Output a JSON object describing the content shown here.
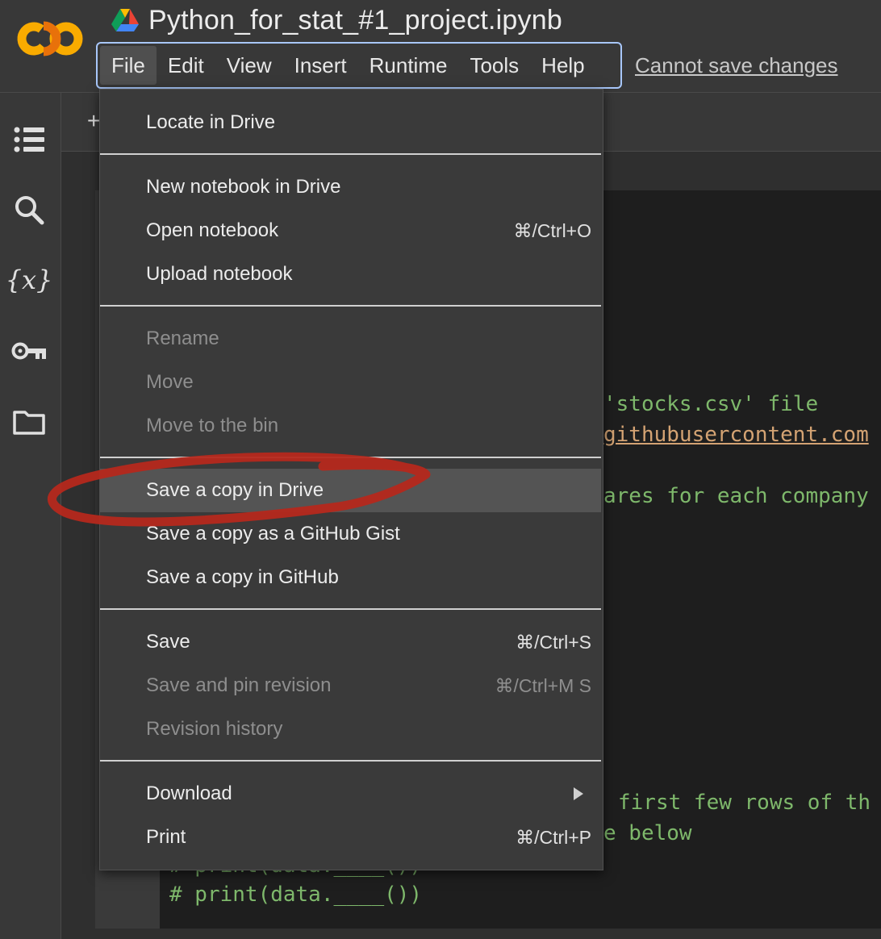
{
  "app": {
    "title": "Python_for_stat_#1_project.ipynb",
    "save_status": "Cannot save changes"
  },
  "menubar": [
    "File",
    "Edit",
    "View",
    "Insert",
    "Runtime",
    "Tools",
    "Help"
  ],
  "toolbar": {
    "add_symbol": "+"
  },
  "sidebar": {
    "icons": [
      "table-of-contents-icon",
      "search-icon",
      "variables-icon",
      "secrets-key-icon",
      "files-folder-icon"
    ],
    "variables_glyph": "{x}"
  },
  "file_menu": {
    "items": [
      {
        "label": "Locate in Drive",
        "shortcut": "",
        "disabled": false
      },
      {
        "label": "New notebook in Drive",
        "shortcut": "",
        "disabled": false
      },
      {
        "label": "Open notebook",
        "shortcut": "⌘/Ctrl+O",
        "disabled": false
      },
      {
        "label": "Upload notebook",
        "shortcut": "",
        "disabled": false
      },
      {
        "label": "Rename",
        "shortcut": "",
        "disabled": true
      },
      {
        "label": "Move",
        "shortcut": "",
        "disabled": true
      },
      {
        "label": "Move to the bin",
        "shortcut": "",
        "disabled": true
      },
      {
        "label": "Save a copy in Drive",
        "shortcut": "",
        "disabled": false,
        "highlighted": true
      },
      {
        "label": "Save a copy as a GitHub Gist",
        "shortcut": "",
        "disabled": false
      },
      {
        "label": "Save a copy in GitHub",
        "shortcut": "",
        "disabled": false
      },
      {
        "label": "Save",
        "shortcut": "⌘/Ctrl+S",
        "disabled": false
      },
      {
        "label": "Save and pin revision",
        "shortcut": "⌘/Ctrl+M S",
        "disabled": true
      },
      {
        "label": "Revision history",
        "shortcut": "",
        "disabled": true
      },
      {
        "label": "Download",
        "shortcut": "",
        "disabled": false,
        "submenu": true
      },
      {
        "label": "Print",
        "shortcut": "⌘/Ctrl+P",
        "disabled": false
      }
    ]
  },
  "code_fragments": {
    "line1_str": "'stocks.csv'",
    "line1_rest": " file",
    "line2": "githubusercontent.com",
    "line3": "ares for each company",
    "line4": "first few rows of th",
    "line5": "e below",
    "line6_hidden": "# print(data.____())",
    "line7": "# print(data.____())"
  },
  "colors": {
    "menu_bg": "#3a3a3a",
    "hover_bg": "#545454",
    "annotation": "#b5281c",
    "comment": "#7eb86b",
    "string": "#d4a373",
    "focus_border": "#a8c7fa"
  }
}
